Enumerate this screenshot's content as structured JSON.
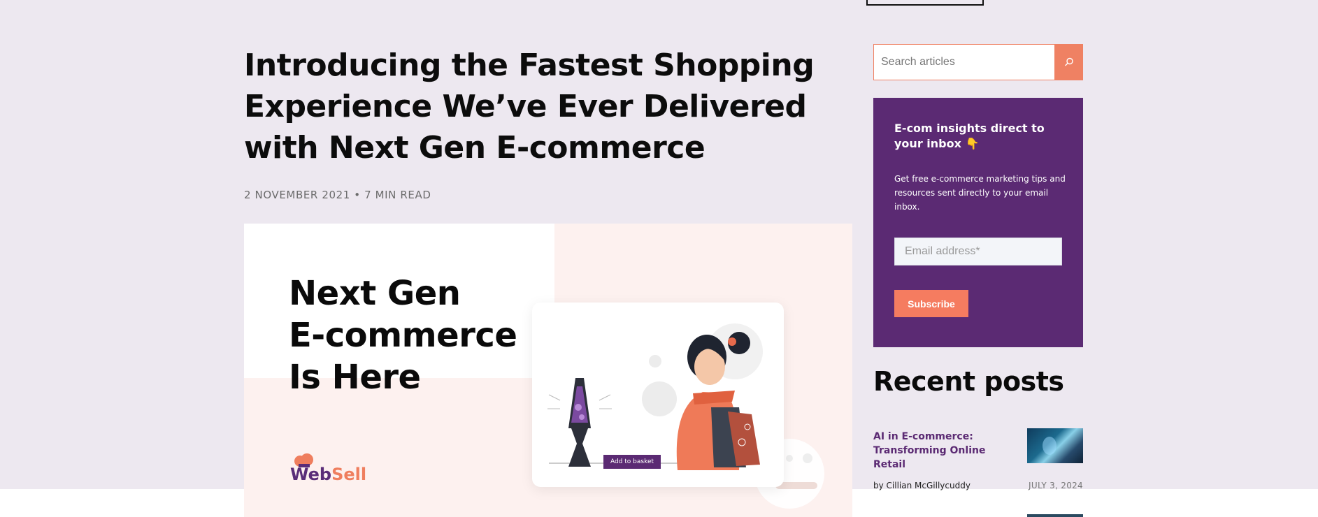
{
  "article": {
    "title": "Introducing the Fastest Shopping Experience We’ve Ever Delivered with Next Gen E-commerce",
    "date": "2 NOVEMBER 2021",
    "separator": "•",
    "read_time": "7 MIN READ"
  },
  "hero": {
    "heading_lines": [
      "Next Gen",
      "E-commerce",
      "Is Here"
    ],
    "add_to_basket_label": "Add to basket",
    "logo_web": "Web",
    "logo_sell": "Sell"
  },
  "search": {
    "placeholder": "Search articles",
    "icon": "search-icon"
  },
  "newsletter": {
    "title": "E-com insights direct to your inbox 👇",
    "text": "Get free e-commerce marketing tips and resources sent directly to your email inbox.",
    "email_placeholder": "Email address*",
    "subscribe_label": "Subscribe"
  },
  "recent_posts": {
    "title": "Recent posts",
    "items": [
      {
        "title": "AI in E-commerce: Transforming Online Retail",
        "author": "by Cillian McGillycuddy",
        "date": "JULY 3, 2024"
      }
    ]
  },
  "colors": {
    "page_bg": "#ede8f0",
    "accent_orange": "#ef8163",
    "brand_purple": "#5b2a73"
  }
}
